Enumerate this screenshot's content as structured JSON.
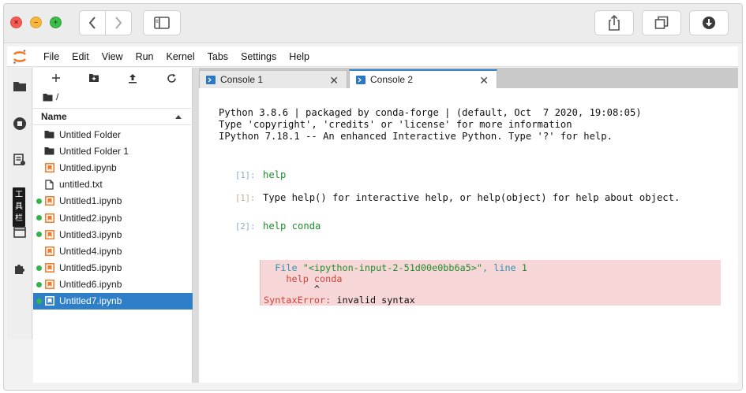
{
  "window": {
    "traffic": {
      "close": "×",
      "minimize": "–",
      "maximize": "+"
    }
  },
  "menu": [
    "File",
    "Edit",
    "View",
    "Run",
    "Kernel",
    "Tabs",
    "Settings",
    "Help"
  ],
  "rail": {
    "vertical_tag": "工\n具\n栏"
  },
  "filebrowser": {
    "path": "/",
    "header": "Name",
    "items": [
      {
        "name": "Untitled Folder",
        "type": "folder",
        "running": false,
        "selected": false
      },
      {
        "name": "Untitled Folder 1",
        "type": "folder",
        "running": false,
        "selected": false
      },
      {
        "name": "Untitled.ipynb",
        "type": "notebook",
        "running": false,
        "selected": false
      },
      {
        "name": "untitled.txt",
        "type": "file",
        "running": false,
        "selected": false
      },
      {
        "name": "Untitled1.ipynb",
        "type": "notebook",
        "running": true,
        "selected": false
      },
      {
        "name": "Untitled2.ipynb",
        "type": "notebook",
        "running": true,
        "selected": false
      },
      {
        "name": "Untitled3.ipynb",
        "type": "notebook",
        "running": true,
        "selected": false
      },
      {
        "name": "Untitled4.ipynb",
        "type": "notebook",
        "running": false,
        "selected": false
      },
      {
        "name": "Untitled5.ipynb",
        "type": "notebook",
        "running": true,
        "selected": false
      },
      {
        "name": "Untitled6.ipynb",
        "type": "notebook",
        "running": true,
        "selected": false
      },
      {
        "name": "Untitled7.ipynb",
        "type": "notebook",
        "running": true,
        "selected": true
      }
    ]
  },
  "tabs": [
    {
      "label": "Console 1",
      "close": "✕"
    },
    {
      "label": "Console 2",
      "close": "✕"
    }
  ],
  "console": {
    "banner": [
      "Python 3.8.6 | packaged by conda-forge | (default, Oct  7 2020, 19:08:05)",
      "Type 'copyright', 'credits' or 'license' for more information",
      "IPython 7.18.1 -- An enhanced Interactive Python. Type '?' for help."
    ],
    "cells": [
      {
        "prompt": "[1]:",
        "kind": "in",
        "text": "help"
      },
      {
        "prompt": "[1]:",
        "kind": "out",
        "text": "Type help() for interactive help, or help(object) for help about object."
      },
      {
        "prompt": "[2]:",
        "kind": "in",
        "text": "help conda"
      }
    ],
    "error": {
      "file_kw": "File",
      "file_name": "\"<ipython-input-2-51d00e0bb6a5>\"",
      "line_kw": ", line",
      "line_no": "1",
      "code": "help conda",
      "caret": "^",
      "error_type": "SyntaxError:",
      "error_msg": "invalid syntax"
    }
  },
  "colors": {
    "accent": "#2f7fc8",
    "running_dot": "#35b34a",
    "notebook_icon": "#f37726",
    "error_bg": "#f6d6d6"
  }
}
